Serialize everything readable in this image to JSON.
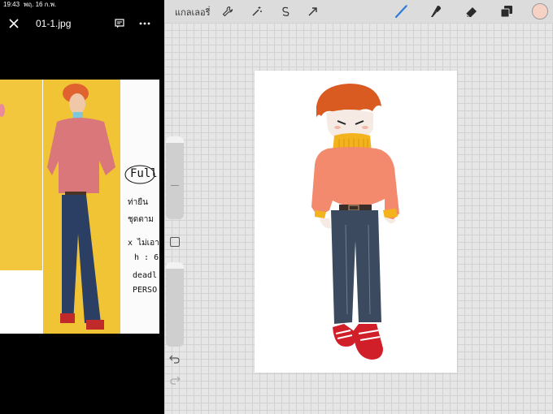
{
  "status_bar": {
    "time": "19:43",
    "date": "พฤ. 16 ก.พ."
  },
  "viewer": {
    "filename": "01-1.jpg",
    "icons": {
      "close": "close-icon",
      "comment": "comment-icon",
      "more": "more-icon"
    },
    "note_text": [
      "Full",
      "ท่ายืน",
      "ชุดตาม",
      "x ไม่เอา",
      "h : 6",
      "deadl",
      "PERSO"
    ]
  },
  "procreate": {
    "gallery_label": "แกลเลอรี่",
    "tools_left": [
      "wrench-icon",
      "magic-wand-icon",
      "selection-icon",
      "transform-arrow-icon"
    ],
    "tools_right": [
      "brush-icon",
      "smudge-icon",
      "eraser-icon",
      "layers-icon",
      "color-swatch"
    ],
    "colors": {
      "active_tool": "#2f7bd8",
      "current_color": "#f7d2c4"
    },
    "sidebar": [
      "brush-size-slider",
      "modify-button",
      "opacity-slider",
      "undo-icon",
      "redo-icon"
    ]
  }
}
